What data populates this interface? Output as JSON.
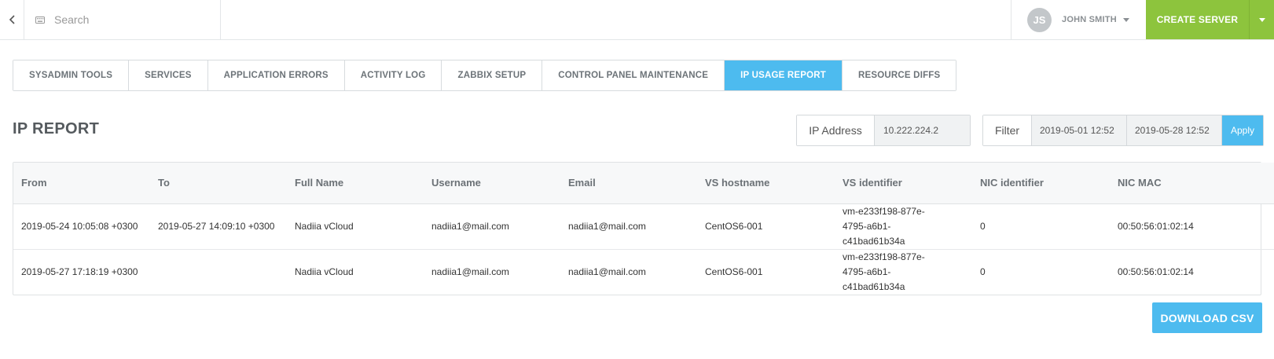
{
  "topbar": {
    "search_placeholder": "Search",
    "user": {
      "initials": "JS",
      "name": "JOHN SMITH"
    },
    "create_server_label": "CREATE SERVER"
  },
  "tabs": [
    {
      "label": "SYSADMIN TOOLS",
      "active": false
    },
    {
      "label": "SERVICES",
      "active": false
    },
    {
      "label": "APPLICATION ERRORS",
      "active": false
    },
    {
      "label": "ACTIVITY LOG",
      "active": false
    },
    {
      "label": "ZABBIX SETUP",
      "active": false
    },
    {
      "label": "CONTROL PANEL MAINTENANCE",
      "active": false
    },
    {
      "label": "IP USAGE REPORT",
      "active": true
    },
    {
      "label": "RESOURCE DIFFS",
      "active": false
    }
  ],
  "page": {
    "title": "IP REPORT"
  },
  "ip_filter": {
    "label": "IP Address",
    "value": "10.222.224.2"
  },
  "date_filter": {
    "label": "Filter",
    "from": "2019-05-01 12:52",
    "to": "2019-05-28 12:52",
    "apply_label": "Apply"
  },
  "table": {
    "columns": [
      "From",
      "To",
      "Full Name",
      "Username",
      "Email",
      "VS hostname",
      "VS identifier",
      "NIC identifier",
      "NIC MAC"
    ],
    "rows": [
      [
        "2019-05-24 10:05:08 +0300",
        "2019-05-27 14:09:10 +0300",
        "Nadiia vCloud",
        "nadiia1@mail.com",
        "nadiia1@mail.com",
        "CentOS6-001",
        "vm-e233f198-877e-4795-a6b1-c41bad61b34a",
        "0",
        "00:50:56:01:02:14"
      ],
      [
        "2019-05-27 17:18:19 +0300",
        "",
        "Nadiia vCloud",
        "nadiia1@mail.com",
        "nadiia1@mail.com",
        "CentOS6-001",
        "vm-e233f198-877e-4795-a6b1-c41bad61b34a",
        "0",
        "00:50:56:01:02:14"
      ]
    ]
  },
  "download_label": "DOWNLOAD CSV",
  "colors": {
    "accent_blue": "#4dbbef",
    "create_green": "#8dc43d"
  },
  "icons": {
    "back": "chevron-left-icon",
    "search": "keyboard-icon",
    "user_caret": "caret-down-icon",
    "create_caret": "caret-down-icon"
  }
}
